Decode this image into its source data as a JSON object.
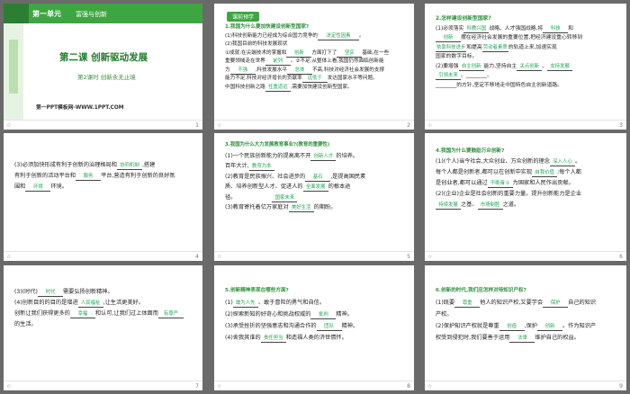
{
  "slides": [
    {
      "num": "1",
      "unit_title": "第一单元",
      "unit_sub": "富强与创新",
      "lesson_title": "第二课  创新驱动发展",
      "lesson_sub": "第2课时    创新永无止境",
      "footer": "第一PPT模板网-WWW.1PPT.COM"
    },
    {
      "num": "2",
      "tag": "课前预学",
      "q1": "1.我国为什么要加快建设创新型国家?",
      "l1a": "(1)科技创新能力已经成为综合国力竞争的",
      "b1": "决定性因素",
      "l2": "(2)我国目前的科技发展现状",
      "l3a": "①成就:在尖端技术的掌握和",
      "b2": "创新",
      "l3b": "方面打下了",
      "b3": "坚实",
      "l3c": "基础,在一些",
      "l4a": "重要领域走在世界",
      "b4": "前列",
      "l4b": "。②不足:从整体上看,我国仍然面临创新能",
      "l5a": "力",
      "b5": "不强",
      "l5b": ",科技发展水平",
      "b6": "总体",
      "l5c": "不高,科技对经济社会发展的支撑",
      "l6": "能力不足,科技对经济增长的贡献率",
      "b7": "远低于",
      "l6b": "发达国家水平等问题。",
      "l7a": "中国科技创新之路",
      "b8": "任重道远",
      "l7b": ",需要加快建设创新型国家。"
    },
    {
      "num": "3",
      "q": "2.怎样建设创新型国家?",
      "l1a": "(1)必须落实",
      "b1": "科教兴国",
      "l1b": "战略、人才强国战略,将",
      "b2": "科技",
      "l1c": "和",
      "l2a": "",
      "b3": "创新",
      "l2b": "摆在经济社会发展的重要位置,把经济建设重心转移到",
      "l3a": "依靠科技进步",
      "b4": "依靠科技进步",
      "l3b": "和提高",
      "b5": "劳动者素质",
      "l3c": "的轨道上来,加速实现",
      "l4": "国家的数字目标。",
      "l5a": "(2)要增强",
      "b6": "自主创新",
      "l5b": "能力,坚持自主",
      "b7": "关点创新",
      "b8": "支持发展",
      "l6a": "",
      "b9": "引领未来",
      "l6b": "、________、",
      "l7": "________的方针,坚定不移地走中国特色自主创新道路。"
    },
    {
      "num": "4",
      "l1a": "(3)必须加快形成有利于创新的治理格局和",
      "b1": "协同机制",
      "l1b": ",搭建",
      "l2a": "有利于创新的活动平台和",
      "b2": "服务",
      "l2b": "平台,营造有利于创新的良好氛",
      "l3a": "围和",
      "b3": "环境",
      "l3b": "环境。"
    },
    {
      "num": "5",
      "q": "3.我国为什么大力发展教育事业?(教育的重要性)",
      "l1a": "(1)一个民族创新能力的提高离不开",
      "b1": "创新人才",
      "l1b": "的培养。",
      "l2a": "百年大计,",
      "b2": "教育为本",
      "l3a": "(2)教育是民族振兴、社会进步的",
      "b3": "基石",
      "l3b": ",是提高国民素",
      "l4a": "质、培养创新型人才、促进人的",
      "b4": "全面发展",
      "l4b": "的根本途",
      "l5a": "径。",
      "b5": "国家未来",
      "l6a": "(3)教育寄托着亿万家庭对",
      "b6": "美好生活",
      "l6b": "的期盼。"
    },
    {
      "num": "6",
      "q": "4.我国为什么要鼓励万众创新?",
      "l1a": "(1)(个人)当今社会,大众创业、万众创新的理念",
      "b1": "深入人心",
      "l1b": "。",
      "l2a": "每个人都是创新者,都可以在创新中实现",
      "b2": "自我价值",
      "l2b": ";每个人都",
      "l3a": "是创业者,都可以通过",
      "b3": "不断奋斗",
      "l3b": "为国家和人民作出贡献。",
      "l4a": "(2)(企业)企业是社会创新的重要力量。提升创新能力是企业",
      "l5a": "",
      "b4": "持续发展",
      "l5b": "之基、",
      "b5": "市场制胜",
      "l5c": "之道。"
    },
    {
      "num": "7",
      "l1a": "(3)(时代)",
      "b1": "时代",
      "l1b": "需要弘扬创新精神。",
      "l2a": "(4)创新目的的目的是增进",
      "b2": "人民福祉",
      "l2b": ",让生活更美好。",
      "l3a": "创新让我们获得更多的",
      "b3": "幸福",
      "l3b": "和认可,让我们过上体面而",
      "b4": "有尊严",
      "l4": "的生活。"
    },
    {
      "num": "8",
      "q": "5.创新精神表现在哪些方面?",
      "l1a": "(1)",
      "b1": "敢为人先",
      "l1b": "、敢于冒险的勇气和自信。",
      "l2a": "(2)探索新知的好奇心和挑战权威的",
      "b2": "批判",
      "l2b": "精神。",
      "l3a": "(3)承受挫折的坚强意志和沟通合作的",
      "b3": "团队",
      "l3b": "精神。",
      "l4a": "(4)舍我其谁的",
      "b4": "责任担当",
      "l4b": "和造福人类的济世情怀。"
    },
    {
      "num": "9",
      "q": "6.创新的时代,我们应怎样对待知识产权?",
      "l1a": "(1)既要",
      "b1": "尊重",
      "l1b": "他人的知识产权,又要学会",
      "b2": "保护",
      "l1c": "自己的知识",
      "l2": "产权。",
      "l3a": "(2)保护知识产权就是尊重",
      "b3": "创造",
      "l3b": ",保护",
      "b4": "创新",
      "l3c": "。作为知识产",
      "l4a": "权受到侵犯时,我们要善于运用",
      "b5": "法律",
      "l4b": "维护自己的权益。"
    }
  ]
}
